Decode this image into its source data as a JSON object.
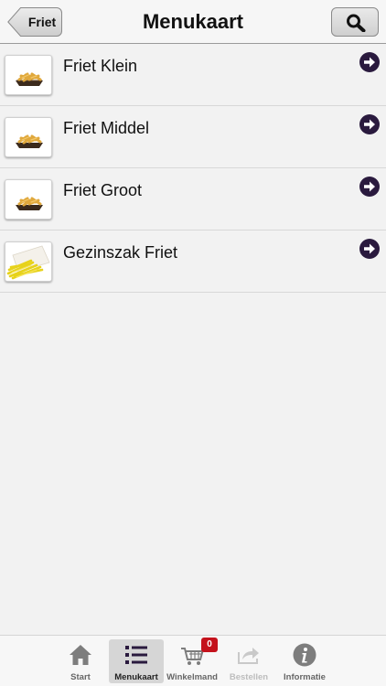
{
  "header": {
    "back_label": "Friet",
    "title": "Menukaart"
  },
  "icons": {
    "back": "back-arrow-icon",
    "search": "search-icon",
    "row_arrow": "arrow-right-circle-icon"
  },
  "colors": {
    "arrow_circle": "#2a1a3e",
    "badge": "#c4121c",
    "tab_active_bg": "#d6d6d6"
  },
  "menu_items": [
    {
      "label": "Friet Klein",
      "image": "fries-tray"
    },
    {
      "label": "Friet Middel",
      "image": "fries-tray"
    },
    {
      "label": "Friet Groot",
      "image": "fries-tray"
    },
    {
      "label": "Gezinszak Friet",
      "image": "fries-bag"
    }
  ],
  "tabbar": {
    "tabs": [
      {
        "label": "Start",
        "icon": "home-icon",
        "state": "normal"
      },
      {
        "label": "Menukaart",
        "icon": "list-icon",
        "state": "active"
      },
      {
        "label": "Winkelmand",
        "icon": "cart-icon",
        "state": "normal",
        "badge": "0"
      },
      {
        "label": "Bestellen",
        "icon": "share-icon",
        "state": "disabled"
      },
      {
        "label": "Informatie",
        "icon": "info-icon",
        "state": "normal"
      }
    ]
  }
}
